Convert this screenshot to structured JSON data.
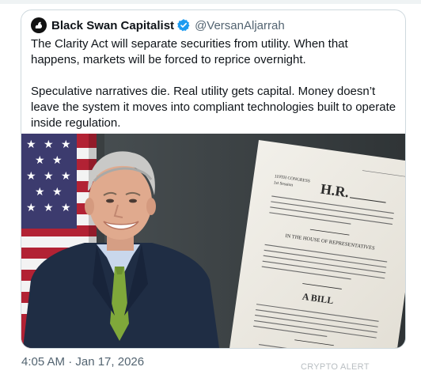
{
  "tweet": {
    "author_name": "Black Swan Capitalist",
    "author_handle": "@VersanAljarrah",
    "paragraphs": [
      "The Clarity Act will separate securities from utility. When that happens, markets will be forced to reprice overnight.",
      "Speculative narratives die. Real utility gets capital. Money doesn’t leave the system it moves into compliant technologies built to operate inside regulation."
    ],
    "timestamp": "4:05 AM · Jan 17, 2026",
    "icons": {
      "avatar": "black-swan-avatar-icon",
      "verified": "verified-badge-icon"
    },
    "colors": {
      "verified": "#1d9bf0",
      "handle": "#536471",
      "text": "#0f1419"
    }
  },
  "document": {
    "congress": "119TH CONGRESS",
    "session": "1st Session",
    "bill_number": "H.R.",
    "house_heading": "IN THE HOUSE OF REPRESENTATIVES",
    "bill_title": "A BILL"
  },
  "watermark": {
    "text": "CRYPTO ALERT"
  }
}
